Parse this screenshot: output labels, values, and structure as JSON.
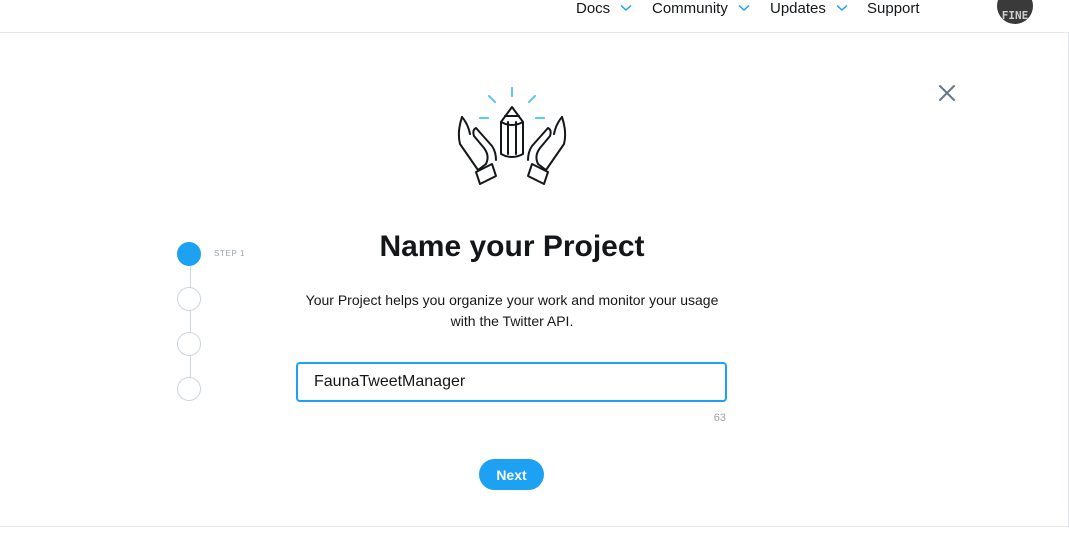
{
  "nav": {
    "items": [
      {
        "label": "Docs",
        "has_dropdown": true
      },
      {
        "label": "Community",
        "has_dropdown": true
      },
      {
        "label": "Updates",
        "has_dropdown": true
      },
      {
        "label": "Support",
        "has_dropdown": false
      }
    ],
    "avatar_text": "FINE"
  },
  "dialog": {
    "illustration_icon": "hands-pencil-icon",
    "close_icon": "close-icon",
    "title": "Name your Project",
    "description": "Your Project helps you organize your work and monitor your usage with the Twitter API.",
    "project_name": {
      "value": "FaunaTweetManager",
      "remaining_chars": "63"
    },
    "next_label": "Next"
  },
  "stepper": {
    "current_label": "STEP 1",
    "total_steps": 4,
    "active_step": 1
  },
  "colors": {
    "accent": "#1da1f2",
    "text": "#14171a",
    "muted": "#9aa4ac",
    "border": "#ccd6dd",
    "illustration_accent": "#6cc3f0"
  }
}
